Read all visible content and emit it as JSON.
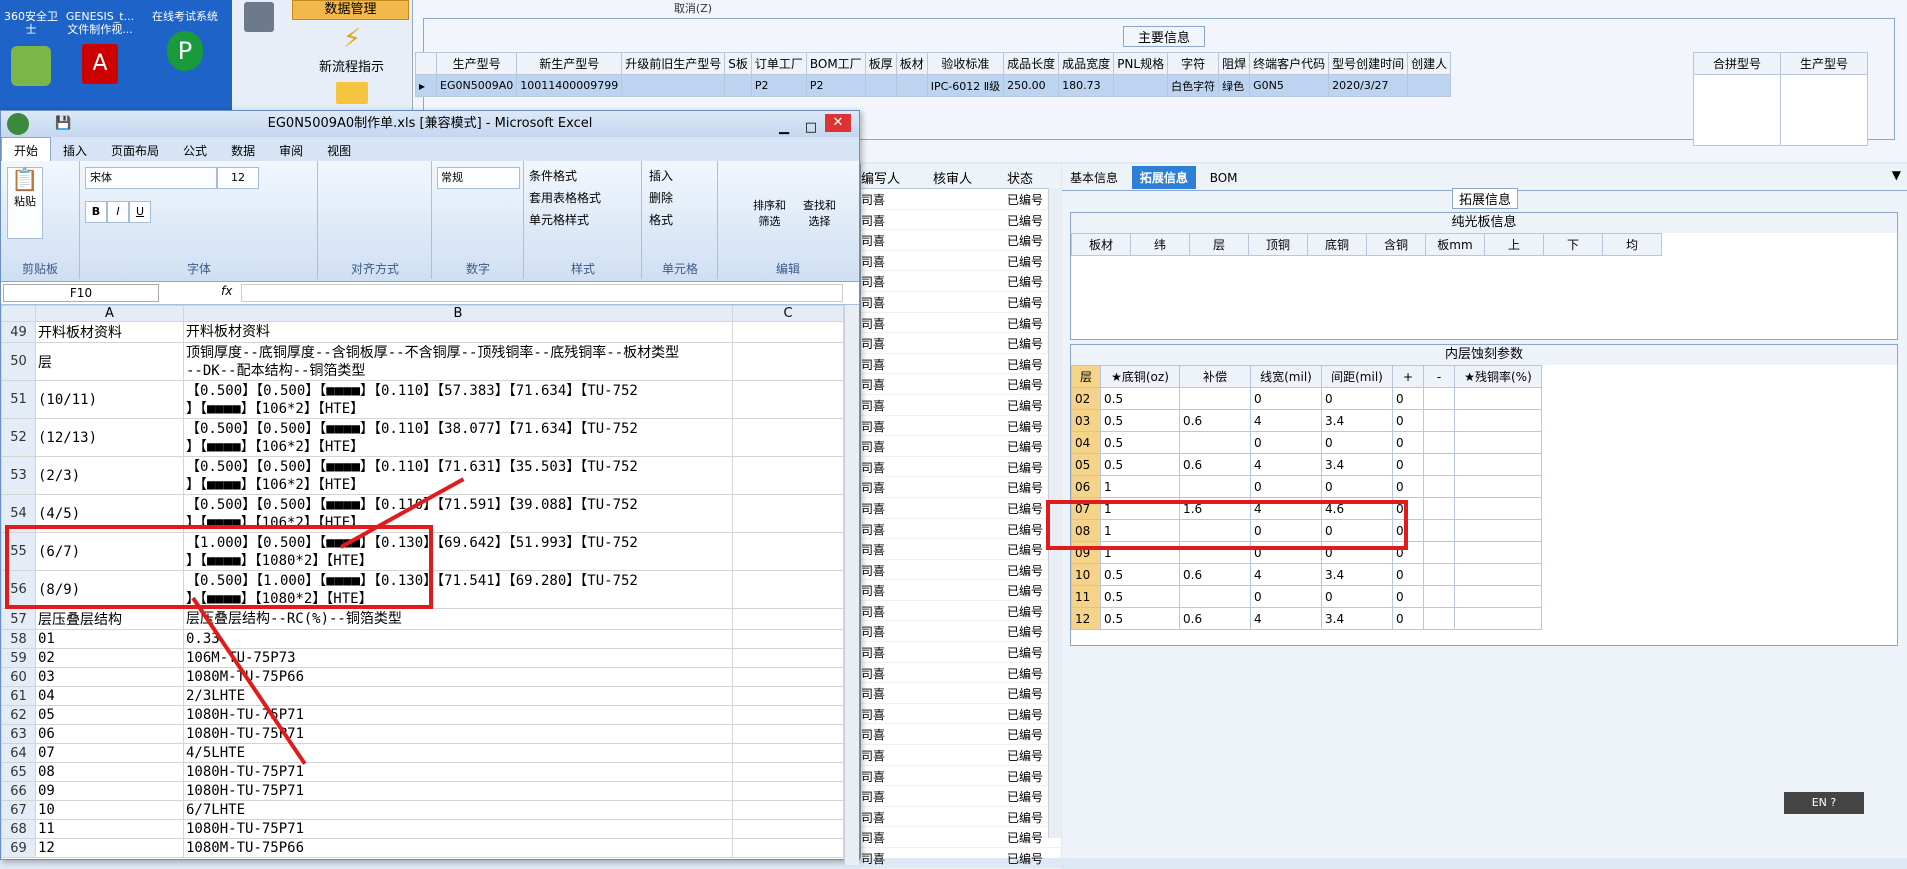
{
  "desktop": {
    "icons": [
      {
        "label": "360安全卫士",
        "icon": "shield-icon"
      },
      {
        "label": "GENESIS_t...\n文件制作视...",
        "icon": "video-file-icon"
      },
      {
        "label": "在线考试系统",
        "icon": "exam-icon"
      }
    ]
  },
  "nav": {
    "data_mgmt": "数据管理",
    "new_process": "新流程指示",
    "cancel_label": "取消(Z)"
  },
  "main_info": {
    "section_title": "主要信息",
    "columns": [
      "生产型号",
      "新生产型号",
      "升级前旧生产型号",
      "S板",
      "订单工厂",
      "BOM工厂",
      "板厚",
      "板材",
      "验收标准",
      "成品长度",
      "成品宽度",
      "PNL规格",
      "字符",
      "阻焊",
      "终端客户代码",
      "型号创建时间",
      "创建人"
    ],
    "row": [
      "EG0N5009A0",
      "10011400009799",
      "",
      "",
      "P2",
      "P2",
      "",
      "",
      "IPC-6012 Ⅱ级",
      "250.00",
      "180.73",
      "",
      "白色字符",
      "绿色",
      "G0N5",
      "2020/3/27",
      ""
    ],
    "merge_columns": [
      "合拼型号",
      "生产型号"
    ]
  },
  "middle_list": {
    "columns": [
      "编写人",
      "核审人",
      "状态"
    ],
    "prefix": "司喜",
    "status": "已编号"
  },
  "right_panel": {
    "tabs": [
      "基本信息",
      "拓展信息",
      "BOM"
    ],
    "section_title": "拓展信息",
    "pure_board_title": "纯光板信息",
    "pure_board_columns": [
      "板材",
      "纬",
      "层",
      "顶铜",
      "底铜",
      "含铜",
      "板mm",
      "上",
      "下",
      "均"
    ],
    "inner_title": "内层蚀刻参数",
    "inner_columns": [
      "层",
      "★底铜(oz)",
      "补偿",
      "线宽(mil)",
      "间距(mil)",
      "+",
      "-",
      "★残铜率(%)"
    ],
    "inner_rows": [
      [
        "02",
        "0.5",
        "",
        "0",
        "0",
        "0"
      ],
      [
        "03",
        "0.5",
        "0.6",
        "4",
        "3.4",
        "0"
      ],
      [
        "04",
        "0.5",
        "",
        "0",
        "0",
        "0"
      ],
      [
        "05",
        "0.5",
        "0.6",
        "4",
        "3.4",
        "0"
      ],
      [
        "06",
        "1",
        "",
        "0",
        "0",
        "0"
      ],
      [
        "07",
        "1",
        "1.6",
        "4",
        "4.6",
        "0"
      ],
      [
        "08",
        "1",
        "",
        "0",
        "0",
        "0"
      ],
      [
        "09",
        "1",
        "",
        "0",
        "0",
        "0"
      ],
      [
        "10",
        "0.5",
        "0.6",
        "4",
        "3.4",
        "0"
      ],
      [
        "11",
        "0.5",
        "",
        "0",
        "0",
        "0"
      ],
      [
        "12",
        "0.5",
        "0.6",
        "4",
        "3.4",
        "0"
      ]
    ],
    "lang": "EN"
  },
  "excel": {
    "title": "EG0N5009A0制作单.xls  [兼容模式] - Microsoft Excel",
    "ribbon_tabs": [
      "开始",
      "插入",
      "页面布局",
      "公式",
      "数据",
      "审阅",
      "视图"
    ],
    "groups": [
      "剪贴板",
      "字体",
      "对齐方式",
      "数字",
      "样式",
      "单元格",
      "编辑"
    ],
    "paste": "粘贴",
    "font_name": "宋体",
    "font_size": "12",
    "number_format": "常规",
    "styles": [
      "条件格式",
      "套用表格格式",
      "单元格样式"
    ],
    "cells_btns": [
      "插入",
      "删除",
      "格式"
    ],
    "edit_btns": [
      "排序和\n筛选",
      "查找和\n选择"
    ],
    "name_box": "F10",
    "col_headers": [
      "A",
      "B",
      "C"
    ],
    "rows": [
      {
        "n": "49",
        "a": "开料板材资料",
        "b": "开料板材资料"
      },
      {
        "n": "50",
        "a": "层",
        "b": "顶铜厚度--底铜厚度--含铜板厚--不含铜厚--顶残铜率--底残铜率--板材类型\n--DK--配本结构--铜箔类型"
      },
      {
        "n": "51",
        "a": "(10/11)",
        "b": "【0.500】【0.500】【■■■■】【0.110】【57.383】【71.634】【TU-752\n】【■■■■】【106*2】【HTE】"
      },
      {
        "n": "52",
        "a": "(12/13)",
        "b": "【0.500】【0.500】【■■■■】【0.110】【38.077】【71.634】【TU-752\n】【■■■■】【106*2】【HTE】"
      },
      {
        "n": "53",
        "a": "(2/3)",
        "b": "【0.500】【0.500】【■■■■】【0.110】【71.631】【35.503】【TU-752\n】【■■■■】【106*2】【HTE】"
      },
      {
        "n": "54",
        "a": "(4/5)",
        "b": "【0.500】【0.500】【■■■■】【0.110】【71.591】【39.088】【TU-752\n】【■■■■】【106*2】【HTE】"
      },
      {
        "n": "55",
        "a": "(6/7)",
        "b": "【1.000】【0.500】【■■■■】【0.130】【69.642】【51.993】【TU-752\n】【■■■■】【1080*2】【HTE】"
      },
      {
        "n": "56",
        "a": "(8/9)",
        "b": "【0.500】【1.000】【■■■■】【0.130】【71.541】【69.280】【TU-752\n】【■■■■】【1080*2】【HTE】"
      },
      {
        "n": "57",
        "a": "层压叠层结构",
        "b": "层压叠层结构--RC(%)--铜箔类型"
      },
      {
        "n": "58",
        "a": "01",
        "b": "0.33"
      },
      {
        "n": "59",
        "a": "02",
        "b": "106M-TU-75P73"
      },
      {
        "n": "60",
        "a": "03",
        "b": "1080M-TU-75P66"
      },
      {
        "n": "61",
        "a": "04",
        "b": "2/3LHTE"
      },
      {
        "n": "62",
        "a": "05",
        "b": "1080H-TU-75P71"
      },
      {
        "n": "63",
        "a": "06",
        "b": "1080H-TU-75P71"
      },
      {
        "n": "64",
        "a": "07",
        "b": "4/5LHTE"
      },
      {
        "n": "65",
        "a": "08",
        "b": "1080H-TU-75P71"
      },
      {
        "n": "66",
        "a": "09",
        "b": "1080H-TU-75P71"
      },
      {
        "n": "67",
        "a": "10",
        "b": "6/7LHTE"
      },
      {
        "n": "68",
        "a": "11",
        "b": "1080H-TU-75P71"
      },
      {
        "n": "69",
        "a": "12",
        "b": "1080M-TU-75P66"
      }
    ]
  }
}
